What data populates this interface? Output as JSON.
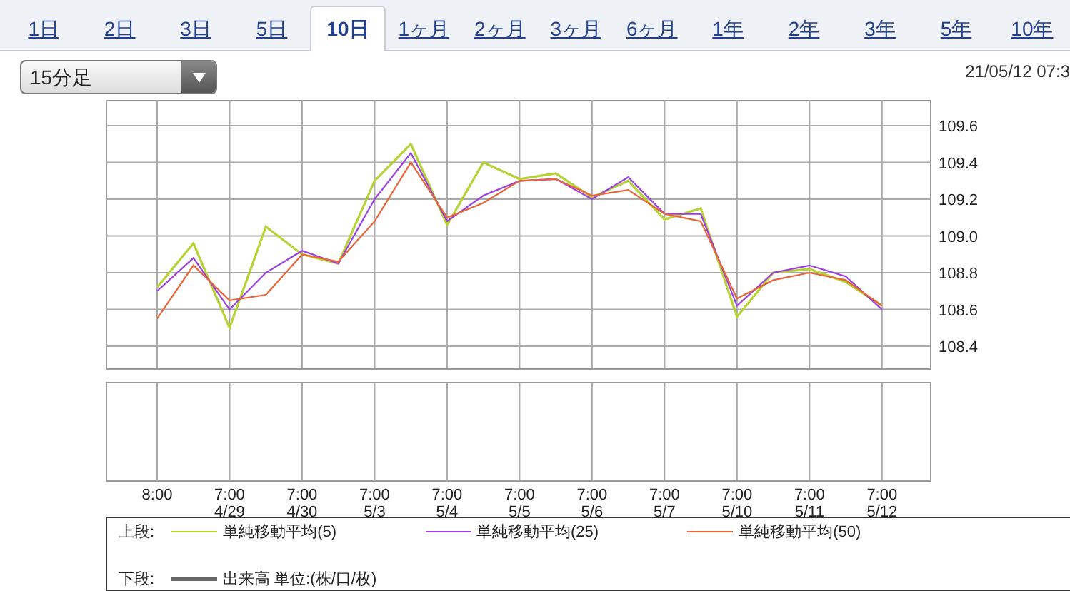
{
  "tabs": [
    {
      "label": "1日",
      "selected": false
    },
    {
      "label": "2日",
      "selected": false
    },
    {
      "label": "3日",
      "selected": false
    },
    {
      "label": "5日",
      "selected": false
    },
    {
      "label": "10日",
      "selected": true
    },
    {
      "label": "1ヶ月",
      "selected": false
    },
    {
      "label": "2ヶ月",
      "selected": false
    },
    {
      "label": "3ヶ月",
      "selected": false
    },
    {
      "label": "6ヶ月",
      "selected": false
    },
    {
      "label": "1年",
      "selected": false
    },
    {
      "label": "2年",
      "selected": false
    },
    {
      "label": "3年",
      "selected": false
    },
    {
      "label": "5年",
      "selected": false
    },
    {
      "label": "10年",
      "selected": false
    }
  ],
  "interval_select": {
    "value": "15分足"
  },
  "timestamp": "21/05/12 07:3",
  "price_chart": {
    "chart_data": {
      "type": "line",
      "ylim": [
        108.28,
        109.74
      ],
      "grid": true,
      "yticks": [
        {
          "value": 108.4,
          "label": "108.4"
        },
        {
          "value": 108.6,
          "label": "108.6"
        },
        {
          "value": 108.8,
          "label": "108.8"
        },
        {
          "value": 109.0,
          "label": "109.0"
        },
        {
          "value": 109.2,
          "label": "109.2"
        },
        {
          "value": 109.4,
          "label": "109.4"
        },
        {
          "value": 109.6,
          "label": "109.6"
        }
      ],
      "series": [
        {
          "name": "単純移動平均(5)",
          "color": "#b5d334",
          "values": [
            108.72,
            108.96,
            108.5,
            109.05,
            108.9,
            108.85,
            109.3,
            109.5,
            109.06,
            109.4,
            109.31,
            109.34,
            109.21,
            109.3,
            109.09,
            109.15,
            108.56,
            108.8,
            108.82,
            108.75,
            108.62
          ]
        },
        {
          "name": "単純移動平均(25)",
          "color": "#9b3fe0",
          "values": [
            108.7,
            108.88,
            108.6,
            108.8,
            108.92,
            108.85,
            109.2,
            109.45,
            109.08,
            109.22,
            109.3,
            109.31,
            109.2,
            109.32,
            109.12,
            109.12,
            108.62,
            108.8,
            108.84,
            108.78,
            108.6
          ]
        },
        {
          "name": "単純移動平均(50)",
          "color": "#e8653a",
          "values": [
            108.55,
            108.84,
            108.65,
            108.68,
            108.9,
            108.86,
            109.08,
            109.4,
            109.1,
            109.18,
            109.3,
            109.31,
            109.22,
            109.25,
            109.12,
            109.08,
            108.66,
            108.76,
            108.8,
            108.76,
            108.62
          ]
        }
      ]
    }
  },
  "time_axis": [
    {
      "time": "8:00"
    },
    {
      "time": "7:00",
      "date": "4/29"
    },
    {
      "time": "7:00",
      "date": "4/30"
    },
    {
      "time": "7:00",
      "date": "5/3"
    },
    {
      "time": "7:00",
      "date": "5/4"
    },
    {
      "time": "7:00",
      "date": "5/5"
    },
    {
      "time": "7:00",
      "date": "5/6"
    },
    {
      "time": "7:00",
      "date": "5/7"
    },
    {
      "time": "7:00",
      "date": "5/10"
    },
    {
      "time": "7:00",
      "date": "5/11"
    },
    {
      "time": "7:00",
      "date": "5/12"
    }
  ],
  "legend": {
    "upper_label": "上段:",
    "lower_label": "下段:",
    "lower_item": "出来高 単位:(株/口/枚)"
  }
}
